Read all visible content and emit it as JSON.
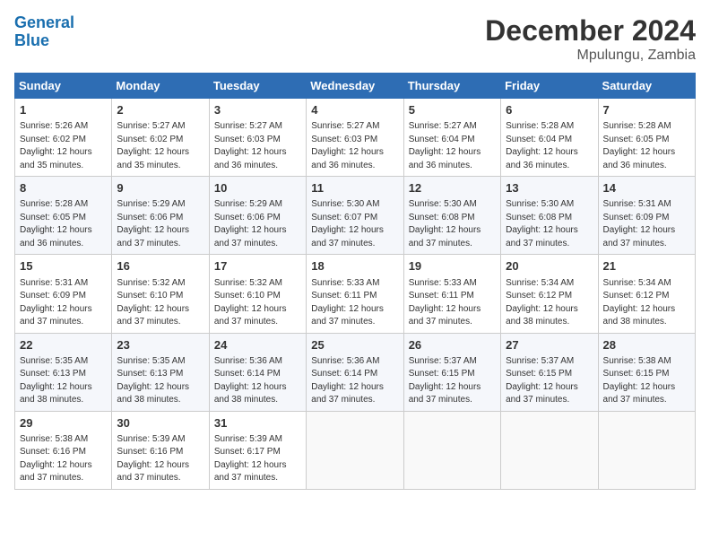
{
  "logo": {
    "line1": "General",
    "line2": "Blue"
  },
  "title": "December 2024",
  "location": "Mpulungu, Zambia",
  "weekdays": [
    "Sunday",
    "Monday",
    "Tuesday",
    "Wednesday",
    "Thursday",
    "Friday",
    "Saturday"
  ],
  "weeks": [
    [
      {
        "day": "1",
        "info": "Sunrise: 5:26 AM\nSunset: 6:02 PM\nDaylight: 12 hours\nand 35 minutes."
      },
      {
        "day": "2",
        "info": "Sunrise: 5:27 AM\nSunset: 6:02 PM\nDaylight: 12 hours\nand 35 minutes."
      },
      {
        "day": "3",
        "info": "Sunrise: 5:27 AM\nSunset: 6:03 PM\nDaylight: 12 hours\nand 36 minutes."
      },
      {
        "day": "4",
        "info": "Sunrise: 5:27 AM\nSunset: 6:03 PM\nDaylight: 12 hours\nand 36 minutes."
      },
      {
        "day": "5",
        "info": "Sunrise: 5:27 AM\nSunset: 6:04 PM\nDaylight: 12 hours\nand 36 minutes."
      },
      {
        "day": "6",
        "info": "Sunrise: 5:28 AM\nSunset: 6:04 PM\nDaylight: 12 hours\nand 36 minutes."
      },
      {
        "day": "7",
        "info": "Sunrise: 5:28 AM\nSunset: 6:05 PM\nDaylight: 12 hours\nand 36 minutes."
      }
    ],
    [
      {
        "day": "8",
        "info": "Sunrise: 5:28 AM\nSunset: 6:05 PM\nDaylight: 12 hours\nand 36 minutes."
      },
      {
        "day": "9",
        "info": "Sunrise: 5:29 AM\nSunset: 6:06 PM\nDaylight: 12 hours\nand 37 minutes."
      },
      {
        "day": "10",
        "info": "Sunrise: 5:29 AM\nSunset: 6:06 PM\nDaylight: 12 hours\nand 37 minutes."
      },
      {
        "day": "11",
        "info": "Sunrise: 5:30 AM\nSunset: 6:07 PM\nDaylight: 12 hours\nand 37 minutes."
      },
      {
        "day": "12",
        "info": "Sunrise: 5:30 AM\nSunset: 6:08 PM\nDaylight: 12 hours\nand 37 minutes."
      },
      {
        "day": "13",
        "info": "Sunrise: 5:30 AM\nSunset: 6:08 PM\nDaylight: 12 hours\nand 37 minutes."
      },
      {
        "day": "14",
        "info": "Sunrise: 5:31 AM\nSunset: 6:09 PM\nDaylight: 12 hours\nand 37 minutes."
      }
    ],
    [
      {
        "day": "15",
        "info": "Sunrise: 5:31 AM\nSunset: 6:09 PM\nDaylight: 12 hours\nand 37 minutes."
      },
      {
        "day": "16",
        "info": "Sunrise: 5:32 AM\nSunset: 6:10 PM\nDaylight: 12 hours\nand 37 minutes."
      },
      {
        "day": "17",
        "info": "Sunrise: 5:32 AM\nSunset: 6:10 PM\nDaylight: 12 hours\nand 37 minutes."
      },
      {
        "day": "18",
        "info": "Sunrise: 5:33 AM\nSunset: 6:11 PM\nDaylight: 12 hours\nand 37 minutes."
      },
      {
        "day": "19",
        "info": "Sunrise: 5:33 AM\nSunset: 6:11 PM\nDaylight: 12 hours\nand 37 minutes."
      },
      {
        "day": "20",
        "info": "Sunrise: 5:34 AM\nSunset: 6:12 PM\nDaylight: 12 hours\nand 38 minutes."
      },
      {
        "day": "21",
        "info": "Sunrise: 5:34 AM\nSunset: 6:12 PM\nDaylight: 12 hours\nand 38 minutes."
      }
    ],
    [
      {
        "day": "22",
        "info": "Sunrise: 5:35 AM\nSunset: 6:13 PM\nDaylight: 12 hours\nand 38 minutes."
      },
      {
        "day": "23",
        "info": "Sunrise: 5:35 AM\nSunset: 6:13 PM\nDaylight: 12 hours\nand 38 minutes."
      },
      {
        "day": "24",
        "info": "Sunrise: 5:36 AM\nSunset: 6:14 PM\nDaylight: 12 hours\nand 38 minutes."
      },
      {
        "day": "25",
        "info": "Sunrise: 5:36 AM\nSunset: 6:14 PM\nDaylight: 12 hours\nand 37 minutes."
      },
      {
        "day": "26",
        "info": "Sunrise: 5:37 AM\nSunset: 6:15 PM\nDaylight: 12 hours\nand 37 minutes."
      },
      {
        "day": "27",
        "info": "Sunrise: 5:37 AM\nSunset: 6:15 PM\nDaylight: 12 hours\nand 37 minutes."
      },
      {
        "day": "28",
        "info": "Sunrise: 5:38 AM\nSunset: 6:15 PM\nDaylight: 12 hours\nand 37 minutes."
      }
    ],
    [
      {
        "day": "29",
        "info": "Sunrise: 5:38 AM\nSunset: 6:16 PM\nDaylight: 12 hours\nand 37 minutes."
      },
      {
        "day": "30",
        "info": "Sunrise: 5:39 AM\nSunset: 6:16 PM\nDaylight: 12 hours\nand 37 minutes."
      },
      {
        "day": "31",
        "info": "Sunrise: 5:39 AM\nSunset: 6:17 PM\nDaylight: 12 hours\nand 37 minutes."
      },
      null,
      null,
      null,
      null
    ]
  ]
}
